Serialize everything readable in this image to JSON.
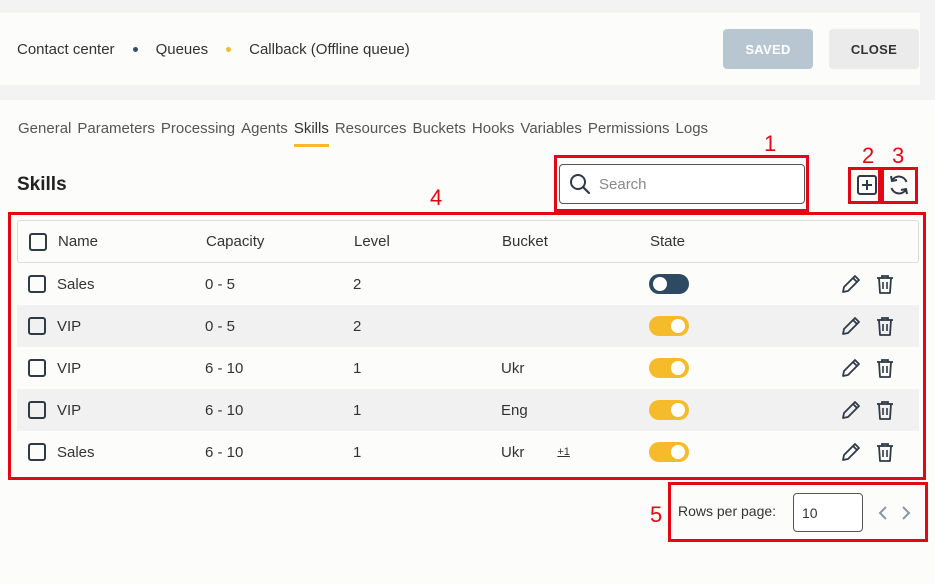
{
  "breadcrumb": {
    "items": [
      "Contact center",
      "Queues",
      "Callback (Offline queue)"
    ],
    "dot_colors": [
      "#36526b",
      "#f5bb2a"
    ]
  },
  "buttons": {
    "saved": "SAVED",
    "close": "CLOSE"
  },
  "tabs": [
    "General",
    "Parameters",
    "Processing",
    "Agents",
    "Skills",
    "Resources",
    "Buckets",
    "Hooks",
    "Variables",
    "Permissions",
    "Logs"
  ],
  "active_tab": "Skills",
  "section_title": "Skills",
  "search": {
    "placeholder": "Search",
    "icon": "search-icon"
  },
  "toolbar": {
    "add_icon": "add-icon",
    "refresh_icon": "refresh-icon"
  },
  "table": {
    "columns": [
      "Name",
      "Capacity",
      "Level",
      "Bucket",
      "State"
    ],
    "rows": [
      {
        "name": "Sales",
        "capacity": "0 - 5",
        "level": "2",
        "bucket": "",
        "more": "",
        "state": "off"
      },
      {
        "name": "VIP",
        "capacity": "0 - 5",
        "level": "2",
        "bucket": "",
        "more": "",
        "state": "on"
      },
      {
        "name": "VIP",
        "capacity": "6 - 10",
        "level": "1",
        "bucket": "Ukr",
        "more": "",
        "state": "on"
      },
      {
        "name": "VIP",
        "capacity": "6 - 10",
        "level": "1",
        "bucket": "Eng",
        "more": "",
        "state": "on"
      },
      {
        "name": "Sales",
        "capacity": "6 - 10",
        "level": "1",
        "bucket": "Ukr",
        "more": "+1",
        "state": "on"
      }
    ]
  },
  "pagination": {
    "rows_per_page_label": "Rows per page:",
    "rows_per_page_value": "10"
  },
  "annotations": {
    "labels": [
      "1",
      "2",
      "3",
      "4",
      "5"
    ],
    "color": "#e30613"
  },
  "colors": {
    "accent": "#f5bb2a",
    "toggle_off": "#2e4a62",
    "saved_button": "#b8c6d1"
  }
}
